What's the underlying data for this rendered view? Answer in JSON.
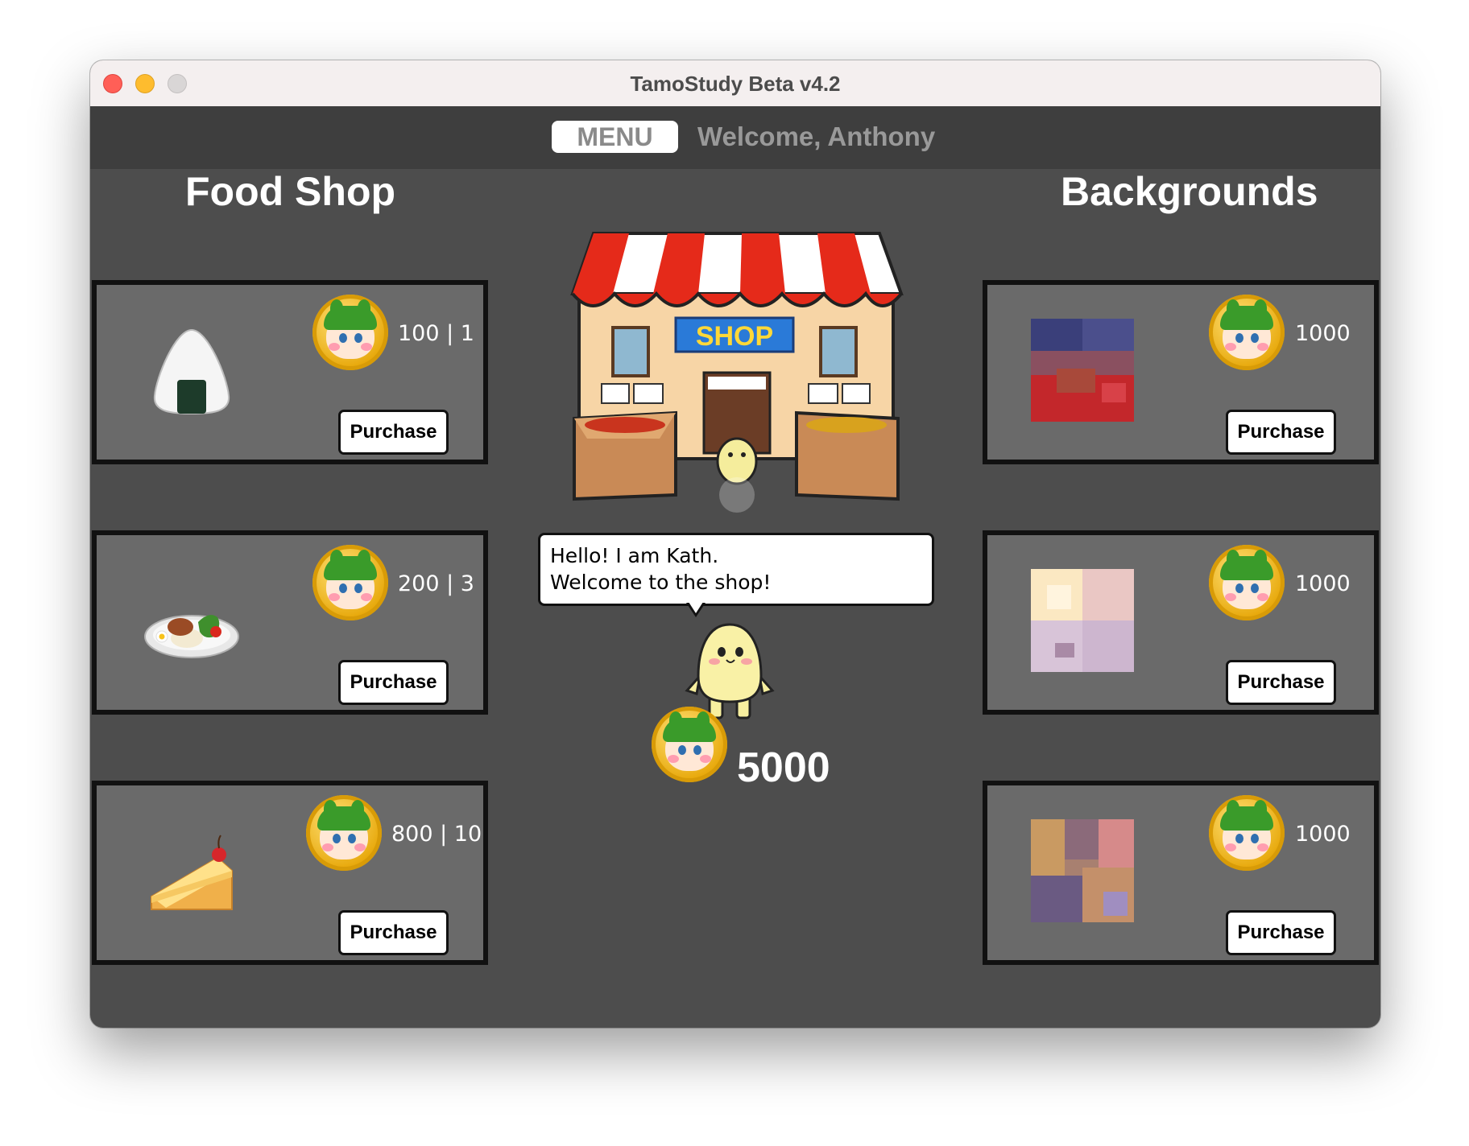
{
  "window": {
    "title": "TamoStudy Beta v4.2"
  },
  "topbar": {
    "menu_label": "MENU",
    "welcome_text": "Welcome, Anthony"
  },
  "food_shop": {
    "title": "Food Shop",
    "items": [
      {
        "name": "onigiri",
        "price": "100 | 1",
        "button": "Purchase"
      },
      {
        "name": "chicken-plate",
        "price": "200 | 3",
        "button": "Purchase"
      },
      {
        "name": "cheesecake",
        "price": "800 | 10",
        "button": "Purchase"
      }
    ]
  },
  "backgrounds": {
    "title": "Backgrounds",
    "items": [
      {
        "name": "background-1",
        "price": "1000",
        "button": "Purchase"
      },
      {
        "name": "background-2",
        "price": "1000",
        "button": "Purchase"
      },
      {
        "name": "background-3",
        "price": "1000",
        "button": "Purchase"
      }
    ]
  },
  "shop_sign": "SHOP",
  "shopkeeper": {
    "line1": "Hello! I am Kath.",
    "line2": "Welcome to the shop!"
  },
  "balance": "5000",
  "colors": {
    "window_bg": "#4d4d4d",
    "card_bg": "#6a6a6a",
    "topbar_bg": "#3e3e3e",
    "coin_gold": "#e8a90c",
    "awning_red": "#e52a1a"
  }
}
